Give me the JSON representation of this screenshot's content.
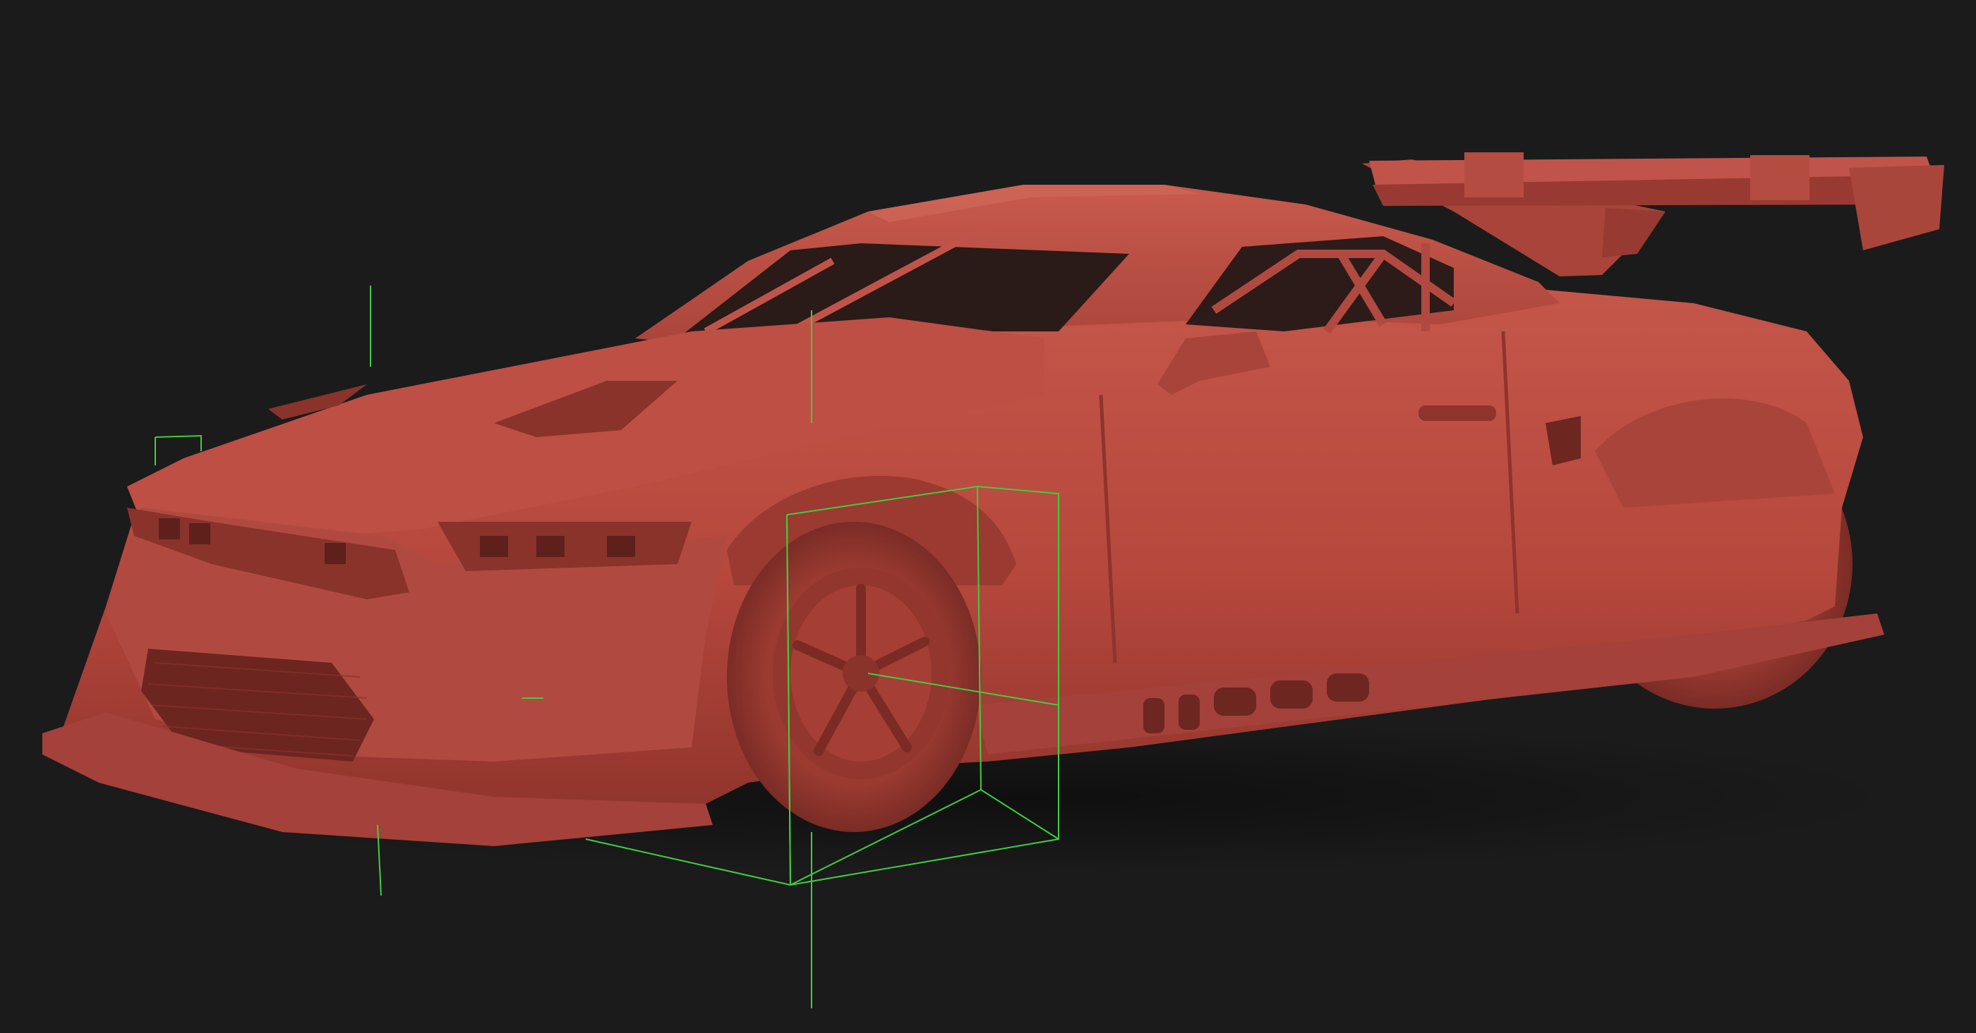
{
  "viewport": {
    "background": "#1b1b1b",
    "model": {
      "type": "race-car-clay-render",
      "body_color": "#b5473c",
      "shadow_color": "#7a2a22",
      "highlight_color": "#c8564a"
    },
    "gizmo": {
      "type": "bounding-box",
      "color": "#3ecf3e"
    }
  }
}
